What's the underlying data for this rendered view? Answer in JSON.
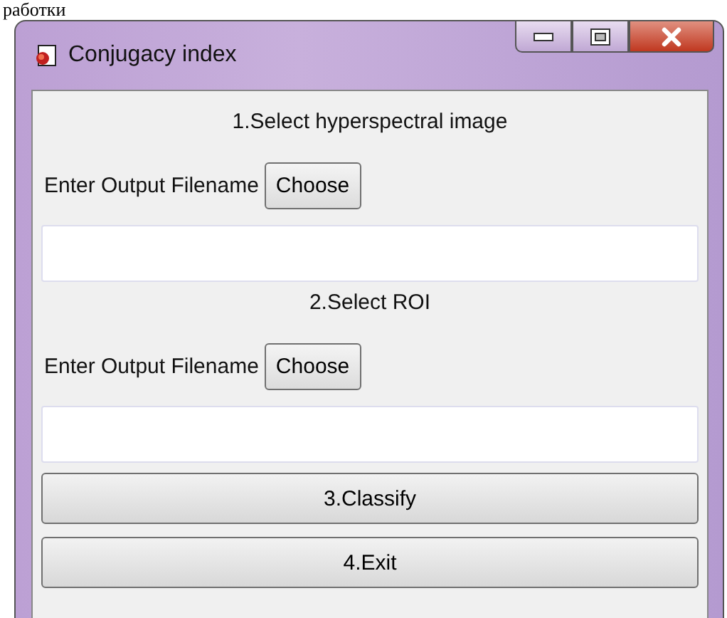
{
  "page_text_fragment": "работки",
  "window": {
    "title": "Conjugacy index"
  },
  "sections": [
    {
      "heading": "1.Select hyperspectral image",
      "label": "Enter Output Filename",
      "button": "Choose"
    },
    {
      "heading": "2.Select ROI",
      "label": "Enter Output Filename",
      "button": "Choose"
    }
  ],
  "buttons": [
    "3.Classify",
    "4.Exit"
  ]
}
